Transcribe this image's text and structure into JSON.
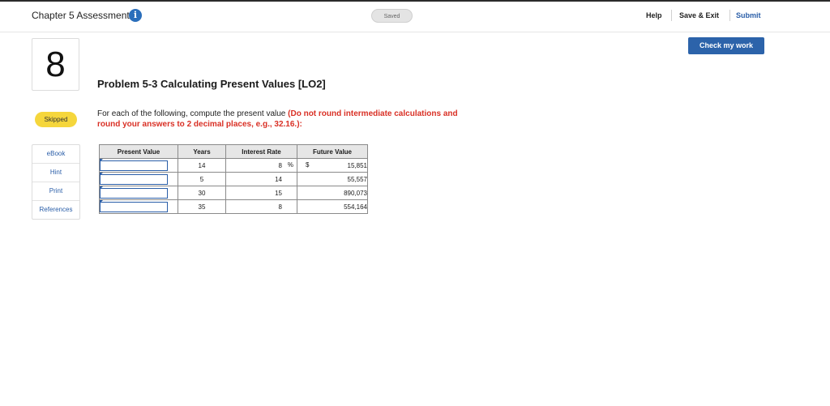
{
  "header": {
    "title": "Chapter 5 Assessment",
    "saved_status": "Saved",
    "help_label": "Help",
    "save_exit_label": "Save & Exit",
    "submit_label": "Submit",
    "info_glyph": "i"
  },
  "check_button_label": "Check my work",
  "question": {
    "number": "8",
    "status": "Skipped",
    "title": "Problem 5-3 Calculating Present Values [LO2]",
    "instruction_plain": "For each of the following, compute the present value ",
    "instruction_emphasis": "(Do not round intermediate calculations and round your answers to 2 decimal places, e.g., 32.16.):"
  },
  "tools": [
    "eBook",
    "Hint",
    "Print",
    "References"
  ],
  "table": {
    "headers": [
      "Present Value",
      "Years",
      "Interest Rate",
      "Future Value"
    ],
    "percent_symbol": "%",
    "dollar_symbol": "$",
    "rows": [
      {
        "present_value": "",
        "years": "14",
        "rate": "8",
        "future_value": "15,851"
      },
      {
        "present_value": "",
        "years": "5",
        "rate": "14",
        "future_value": "55,557"
      },
      {
        "present_value": "",
        "years": "30",
        "rate": "15",
        "future_value": "890,073"
      },
      {
        "present_value": "",
        "years": "35",
        "rate": "8",
        "future_value": "554,164"
      }
    ]
  },
  "colors": {
    "accent_blue": "#2c63aa",
    "skipped_yellow": "#f5d63c",
    "emphasis_red": "#d93025"
  },
  "icons": {
    "info": "info-icon"
  }
}
